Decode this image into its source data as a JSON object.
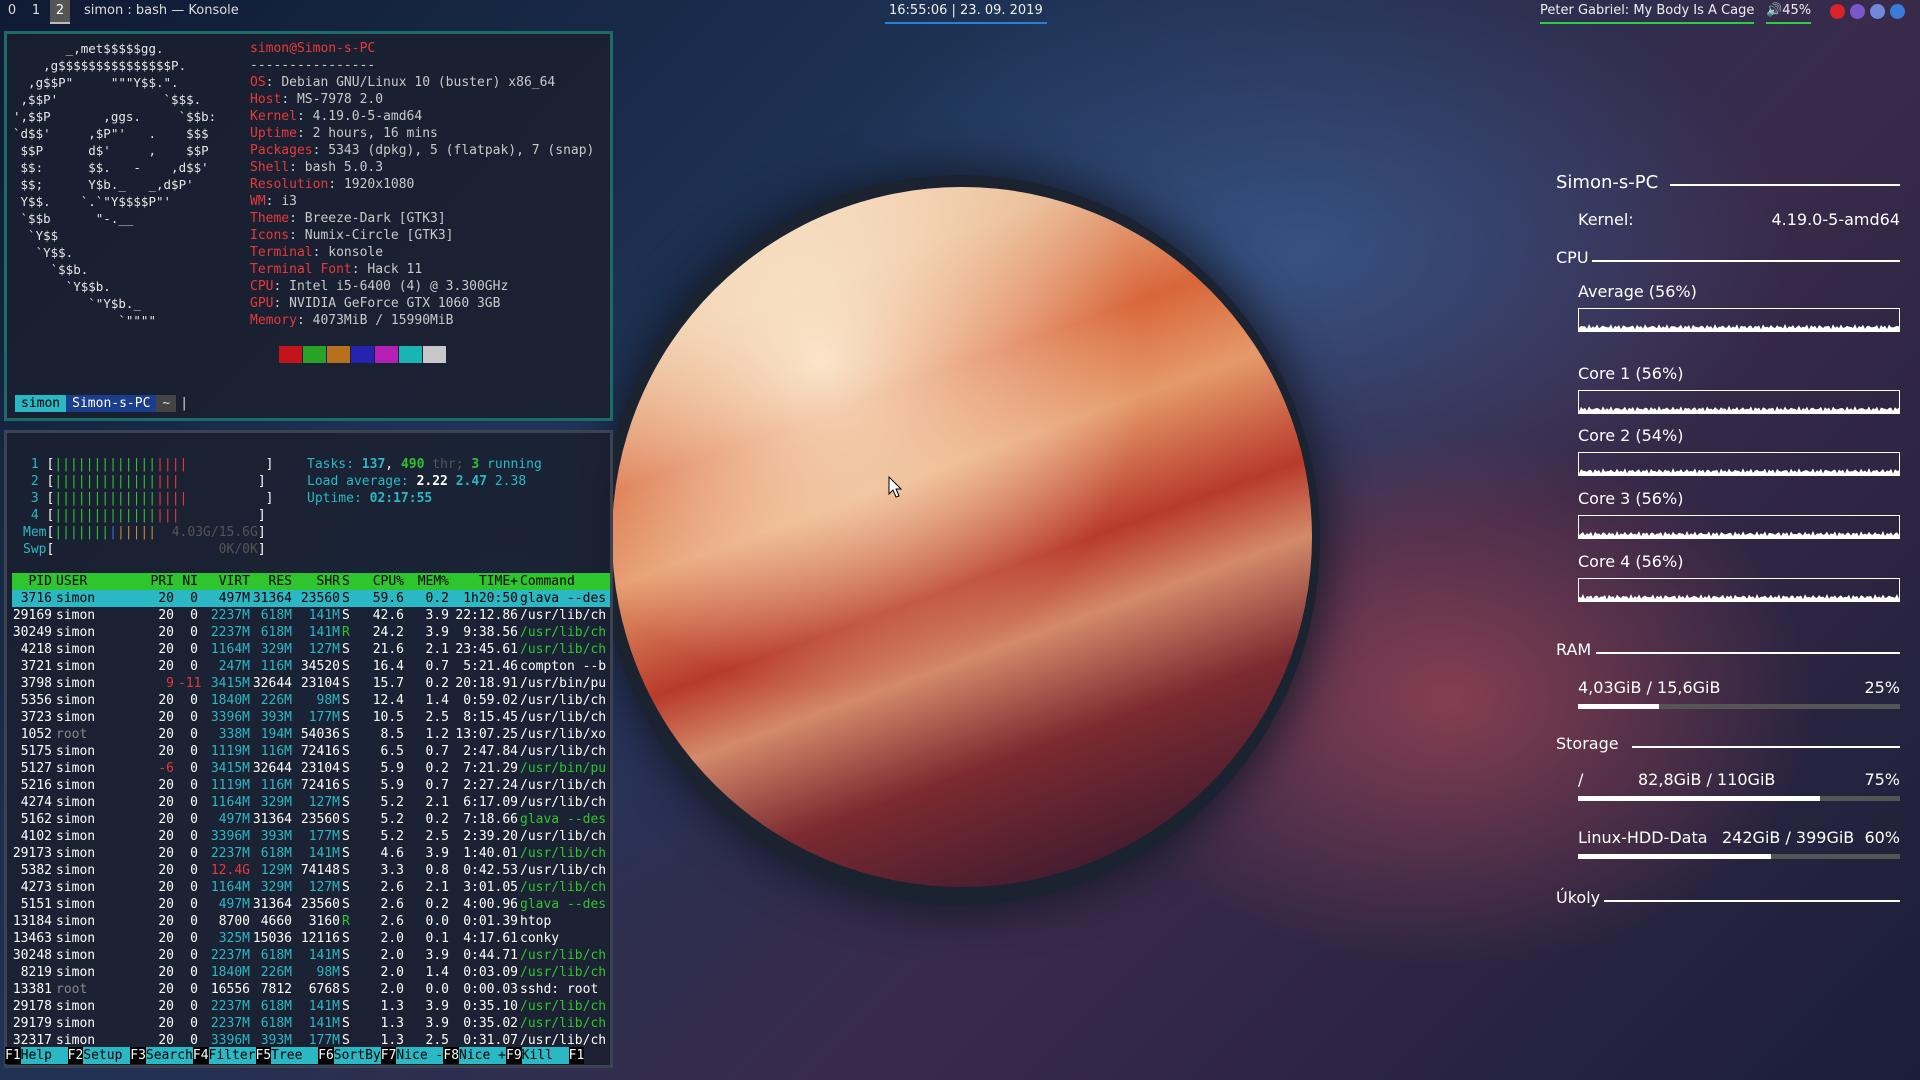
{
  "topbar": {
    "workspaces": [
      "0",
      "1",
      "2"
    ],
    "active_workspace": "2",
    "window_title": "simon : bash — Konsole",
    "clock": "16:55:06 | 23. 09. 2019",
    "now_playing": "Peter Gabriel: My Body Is A Cage",
    "volume": "45%",
    "tray_icons": [
      "gmail-icon",
      "viber-icon",
      "discord-icon",
      "app-icon"
    ]
  },
  "neofetch": {
    "user_host": "simon@Simon-s-PC",
    "separator": "----------------",
    "info": [
      {
        "k": "OS",
        "v": "Debian GNU/Linux 10 (buster) x86_64"
      },
      {
        "k": "Host",
        "v": "MS-7978 2.0"
      },
      {
        "k": "Kernel",
        "v": "4.19.0-5-amd64"
      },
      {
        "k": "Uptime",
        "v": "2 hours, 16 mins"
      },
      {
        "k": "Packages",
        "v": "5343 (dpkg), 5 (flatpak), 7 (snap)"
      },
      {
        "k": "Shell",
        "v": "bash 5.0.3"
      },
      {
        "k": "Resolution",
        "v": "1920x1080"
      },
      {
        "k": "WM",
        "v": "i3"
      },
      {
        "k": "Theme",
        "v": "Breeze-Dark [GTK3]"
      },
      {
        "k": "Icons",
        "v": "Numix-Circle [GTK3]"
      },
      {
        "k": "Terminal",
        "v": "konsole"
      },
      {
        "k": "Terminal Font",
        "v": "Hack 11"
      },
      {
        "k": "CPU",
        "v": "Intel i5-6400 (4) @ 3.300GHz"
      },
      {
        "k": "GPU",
        "v": "NVIDIA GeForce GTX 1060 3GB"
      },
      {
        "k": "Memory",
        "v": "4073MiB / 15990MiB"
      }
    ],
    "logo": [
      "       _,met$$$$$gg.",
      "    ,g$$$$$$$$$$$$$$$P.",
      "  ,g$$P\"     \"\"\"Y$$.\".",
      " ,$$P'              `$$$.",
      "',$$P       ,ggs.     `$$b:",
      "`d$$'     ,$P\"'   .    $$$",
      " $$P      d$'     ,    $$P",
      " $$:      $$.   -    ,d$$'",
      " $$;      Y$b._   _,d$P'",
      " Y$$.    `.`\"Y$$$$P\"'",
      " `$$b      \"-.__",
      "  `Y$$",
      "   `Y$$.",
      "     `$$b.",
      "       `Y$$b.",
      "          `\"Y$b._",
      "              `\"\"\"\""
    ],
    "swatch_colors": [
      "#c4141b",
      "#27a327",
      "#b8701c",
      "#2424b0",
      "#b41fb4",
      "#1bb4b4",
      "#c8c8c8"
    ],
    "prompt": {
      "user": "simon",
      "host": "Simon-s-PC",
      "dir": "~"
    }
  },
  "htop": {
    "cpu_rows": [
      "1",
      "2",
      "3",
      "4"
    ],
    "mem_label": "Mem",
    "mem_value": "4.03G/15.6G",
    "swp_label": "Swp",
    "swp_value": "0K/0K",
    "tasks_label": "Tasks:",
    "tasks": "137",
    "thr": "490",
    "thr_label": "thr;",
    "running": "3",
    "running_label": "running",
    "load_label": "Load average:",
    "load1": "2.22",
    "load5": "2.47",
    "load15": "2.38",
    "uptime_label": "Uptime:",
    "uptime": "02:17:55",
    "columns": [
      "PID",
      "USER",
      "PRI",
      "NI",
      "VIRT",
      "RES",
      "SHR",
      "S",
      "CPU%",
      "MEM%",
      "TIME+",
      "Command"
    ],
    "processes": [
      [
        "3716",
        "simon",
        "20",
        "0",
        "497M",
        "31364",
        "23560",
        "S",
        "59.6",
        "0.2",
        "1h20:50",
        "glava --des"
      ],
      [
        "29169",
        "simon",
        "20",
        "0",
        "2237M",
        "618M",
        "141M",
        "S",
        "42.6",
        "3.9",
        "22:12.86",
        "/usr/lib/ch"
      ],
      [
        "30249",
        "simon",
        "20",
        "0",
        "2237M",
        "618M",
        "141M",
        "R",
        "24.2",
        "3.9",
        "9:38.56",
        "/usr/lib/ch"
      ],
      [
        "4218",
        "simon",
        "20",
        "0",
        "1164M",
        "329M",
        "127M",
        "S",
        "21.6",
        "2.1",
        "23:45.61",
        "/usr/lib/ch"
      ],
      [
        "3721",
        "simon",
        "20",
        "0",
        "247M",
        "116M",
        "34520",
        "S",
        "16.4",
        "0.7",
        "5:21.46",
        "compton --b"
      ],
      [
        "3798",
        "simon",
        "9",
        "-11",
        "3415M",
        "32644",
        "23104",
        "S",
        "15.7",
        "0.2",
        "20:18.91",
        "/usr/bin/pu"
      ],
      [
        "5356",
        "simon",
        "20",
        "0",
        "1840M",
        "226M",
        "98M",
        "S",
        "12.4",
        "1.4",
        "0:59.02",
        "/usr/lib/ch"
      ],
      [
        "3723",
        "simon",
        "20",
        "0",
        "3396M",
        "393M",
        "177M",
        "S",
        "10.5",
        "2.5",
        "8:15.45",
        "/usr/lib/ch"
      ],
      [
        "1052",
        "root",
        "20",
        "0",
        "338M",
        "194M",
        "54036",
        "S",
        "8.5",
        "1.2",
        "13:07.25",
        "/usr/lib/xo"
      ],
      [
        "5175",
        "simon",
        "20",
        "0",
        "1119M",
        "116M",
        "72416",
        "S",
        "6.5",
        "0.7",
        "2:47.84",
        "/usr/lib/ch"
      ],
      [
        "5127",
        "simon",
        "-6",
        "0",
        "3415M",
        "32644",
        "23104",
        "S",
        "5.9",
        "0.2",
        "7:21.29",
        "/usr/bin/pu"
      ],
      [
        "5216",
        "simon",
        "20",
        "0",
        "1119M",
        "116M",
        "72416",
        "S",
        "5.9",
        "0.7",
        "2:27.24",
        "/usr/lib/ch"
      ],
      [
        "4274",
        "simon",
        "20",
        "0",
        "1164M",
        "329M",
        "127M",
        "S",
        "5.2",
        "2.1",
        "6:17.09",
        "/usr/lib/ch"
      ],
      [
        "5162",
        "simon",
        "20",
        "0",
        "497M",
        "31364",
        "23560",
        "S",
        "5.2",
        "0.2",
        "7:18.66",
        "glava --des"
      ],
      [
        "4102",
        "simon",
        "20",
        "0",
        "3396M",
        "393M",
        "177M",
        "S",
        "5.2",
        "2.5",
        "2:39.20",
        "/usr/lib/ch"
      ],
      [
        "29173",
        "simon",
        "20",
        "0",
        "2237M",
        "618M",
        "141M",
        "S",
        "4.6",
        "3.9",
        "1:40.01",
        "/usr/lib/ch"
      ],
      [
        "5382",
        "simon",
        "20",
        "0",
        "12.4G",
        "129M",
        "74148",
        "S",
        "3.3",
        "0.8",
        "0:42.53",
        "/usr/lib/ch"
      ],
      [
        "4273",
        "simon",
        "20",
        "0",
        "1164M",
        "329M",
        "127M",
        "S",
        "2.6",
        "2.1",
        "3:01.05",
        "/usr/lib/ch"
      ],
      [
        "5151",
        "simon",
        "20",
        "0",
        "497M",
        "31364",
        "23560",
        "S",
        "2.6",
        "0.2",
        "4:00.96",
        "glava --des"
      ],
      [
        "13184",
        "simon",
        "20",
        "0",
        "8700",
        "4660",
        "3160",
        "R",
        "2.6",
        "0.0",
        "0:01.39",
        "htop"
      ],
      [
        "13463",
        "simon",
        "20",
        "0",
        "325M",
        "15036",
        "12116",
        "S",
        "2.0",
        "0.1",
        "4:17.61",
        "conky"
      ],
      [
        "30248",
        "simon",
        "20",
        "0",
        "2237M",
        "618M",
        "141M",
        "S",
        "2.0",
        "3.9",
        "0:44.71",
        "/usr/lib/ch"
      ],
      [
        "8219",
        "simon",
        "20",
        "0",
        "1840M",
        "226M",
        "98M",
        "S",
        "2.0",
        "1.4",
        "0:03.09",
        "/usr/lib/ch"
      ],
      [
        "13381",
        "root",
        "20",
        "0",
        "16556",
        "7812",
        "6768",
        "S",
        "2.0",
        "0.0",
        "0:00.03",
        "sshd: root"
      ],
      [
        "29178",
        "simon",
        "20",
        "0",
        "2237M",
        "618M",
        "141M",
        "S",
        "1.3",
        "3.9",
        "0:35.10",
        "/usr/lib/ch"
      ],
      [
        "29179",
        "simon",
        "20",
        "0",
        "2237M",
        "618M",
        "141M",
        "S",
        "1.3",
        "3.9",
        "0:35.02",
        "/usr/lib/ch"
      ],
      [
        "32317",
        "simon",
        "20",
        "0",
        "3396M",
        "393M",
        "177M",
        "S",
        "1.3",
        "2.5",
        "0:31.07",
        "/usr/lib/ch"
      ]
    ],
    "fkeys": [
      {
        "k": "F1",
        "l": "Help  "
      },
      {
        "k": "F2",
        "l": "Setup "
      },
      {
        "k": "F3",
        "l": "Search"
      },
      {
        "k": "F4",
        "l": "Filter"
      },
      {
        "k": "F5",
        "l": "Tree  "
      },
      {
        "k": "F6",
        "l": "SortBy"
      },
      {
        "k": "F7",
        "l": "Nice -"
      },
      {
        "k": "F8",
        "l": "Nice +"
      },
      {
        "k": "F9",
        "l": "Kill  "
      },
      {
        "k": "F1",
        "l": ""
      }
    ]
  },
  "conky": {
    "hostname": "Simon-s-PC",
    "kernel_label": "Kernel:",
    "kernel": "4.19.0-5-amd64",
    "cpu_header": "CPU",
    "cpu_graphs": [
      {
        "label": "Average (56%)",
        "value": 56
      },
      {
        "label": "Core 1 (56%)",
        "value": 56
      },
      {
        "label": "Core 2 (54%)",
        "value": 54
      },
      {
        "label": "Core 3 (56%)",
        "value": 56
      },
      {
        "label": "Core 4 (56%)",
        "value": 56
      }
    ],
    "ram_header": "RAM",
    "ram_text": "4,03GiB / 15,6GiB",
    "ram_pct": "25%",
    "ram_fraction": 0.25,
    "storage_header": "Storage",
    "disks": [
      {
        "name": "/",
        "size": "82,8GiB / 110GiB",
        "pct": "75%",
        "fraction": 0.75
      },
      {
        "name": "Linux-HDD-Data",
        "size": "242GiB  / 399GiB",
        "pct": "60%",
        "fraction": 0.6
      }
    ],
    "tasks_header": "Úkoly"
  },
  "colors": {
    "accent_red": "#e8393a",
    "htop_green": "#2ec52e",
    "htop_cyan": "#2ab8c4",
    "underline_blue": "#2a7fd6"
  }
}
